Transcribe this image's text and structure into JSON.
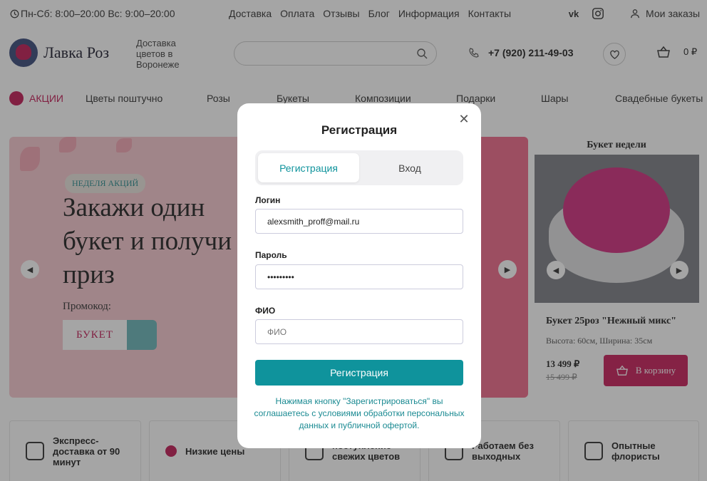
{
  "topbar": {
    "hours": "Пн-Сб: 8:00–20:00 Вс: 9:00–20:00",
    "nav": [
      "Доставка",
      "Оплата",
      "Отзывы",
      "Блог",
      "Информация",
      "Контакты"
    ],
    "social": [
      "vk-icon",
      "instagram-icon"
    ],
    "orders_label": "Мои заказы"
  },
  "header": {
    "logo_text": "Лавка Роз",
    "tagline": "Доставка цветов в Воронеже",
    "search_placeholder": "",
    "phone": "+7 (920) 211-49-03",
    "cart_total": "0 ₽"
  },
  "menu": {
    "promo": "АКЦИИ",
    "items": [
      "Цветы поштучно",
      "Розы",
      "Букеты",
      "Композиции",
      "Подарки",
      "Шары",
      "Свадебные букеты"
    ]
  },
  "banner": {
    "badge": "НЕДЕЛЯ АКЦИЙ",
    "headline": "Закажи один букет и получи приз",
    "promo_label": "Промокод:",
    "promo_code": "БУКЕТ"
  },
  "bouquet": {
    "title": "Букет недели",
    "name": "Букет 25роз \"Нежный микс\"",
    "size": "Высота: 60см, Ширина: 35см",
    "price": "13 499 ₽",
    "old_price": "15 499 ₽",
    "buy_label": "В корзину"
  },
  "features": [
    "Экспресс-доставка от 90 минут",
    "Низкие цены",
    "поступление свежих цветов",
    "Работаем без выходных",
    "Опытные флористы"
  ],
  "modal": {
    "title": "Регистрация",
    "tabs": [
      "Регистрация",
      "Вход"
    ],
    "active_tab": "Регистрация",
    "login_label": "Логин",
    "login_value": "alexsmith_proff@mail.ru",
    "password_label": "Пароль",
    "password_value": "•••••••••",
    "fio_label": "ФИО",
    "fio_placeholder": "ФИО",
    "submit_label": "Регистрация",
    "terms": "Нажимая кнопку \"Зарегистрироваться\" вы соглашаетесь с условиями обработки персональных данных и публичной офертой."
  },
  "colors": {
    "accent": "#0f939c",
    "brand": "#c21a55"
  }
}
